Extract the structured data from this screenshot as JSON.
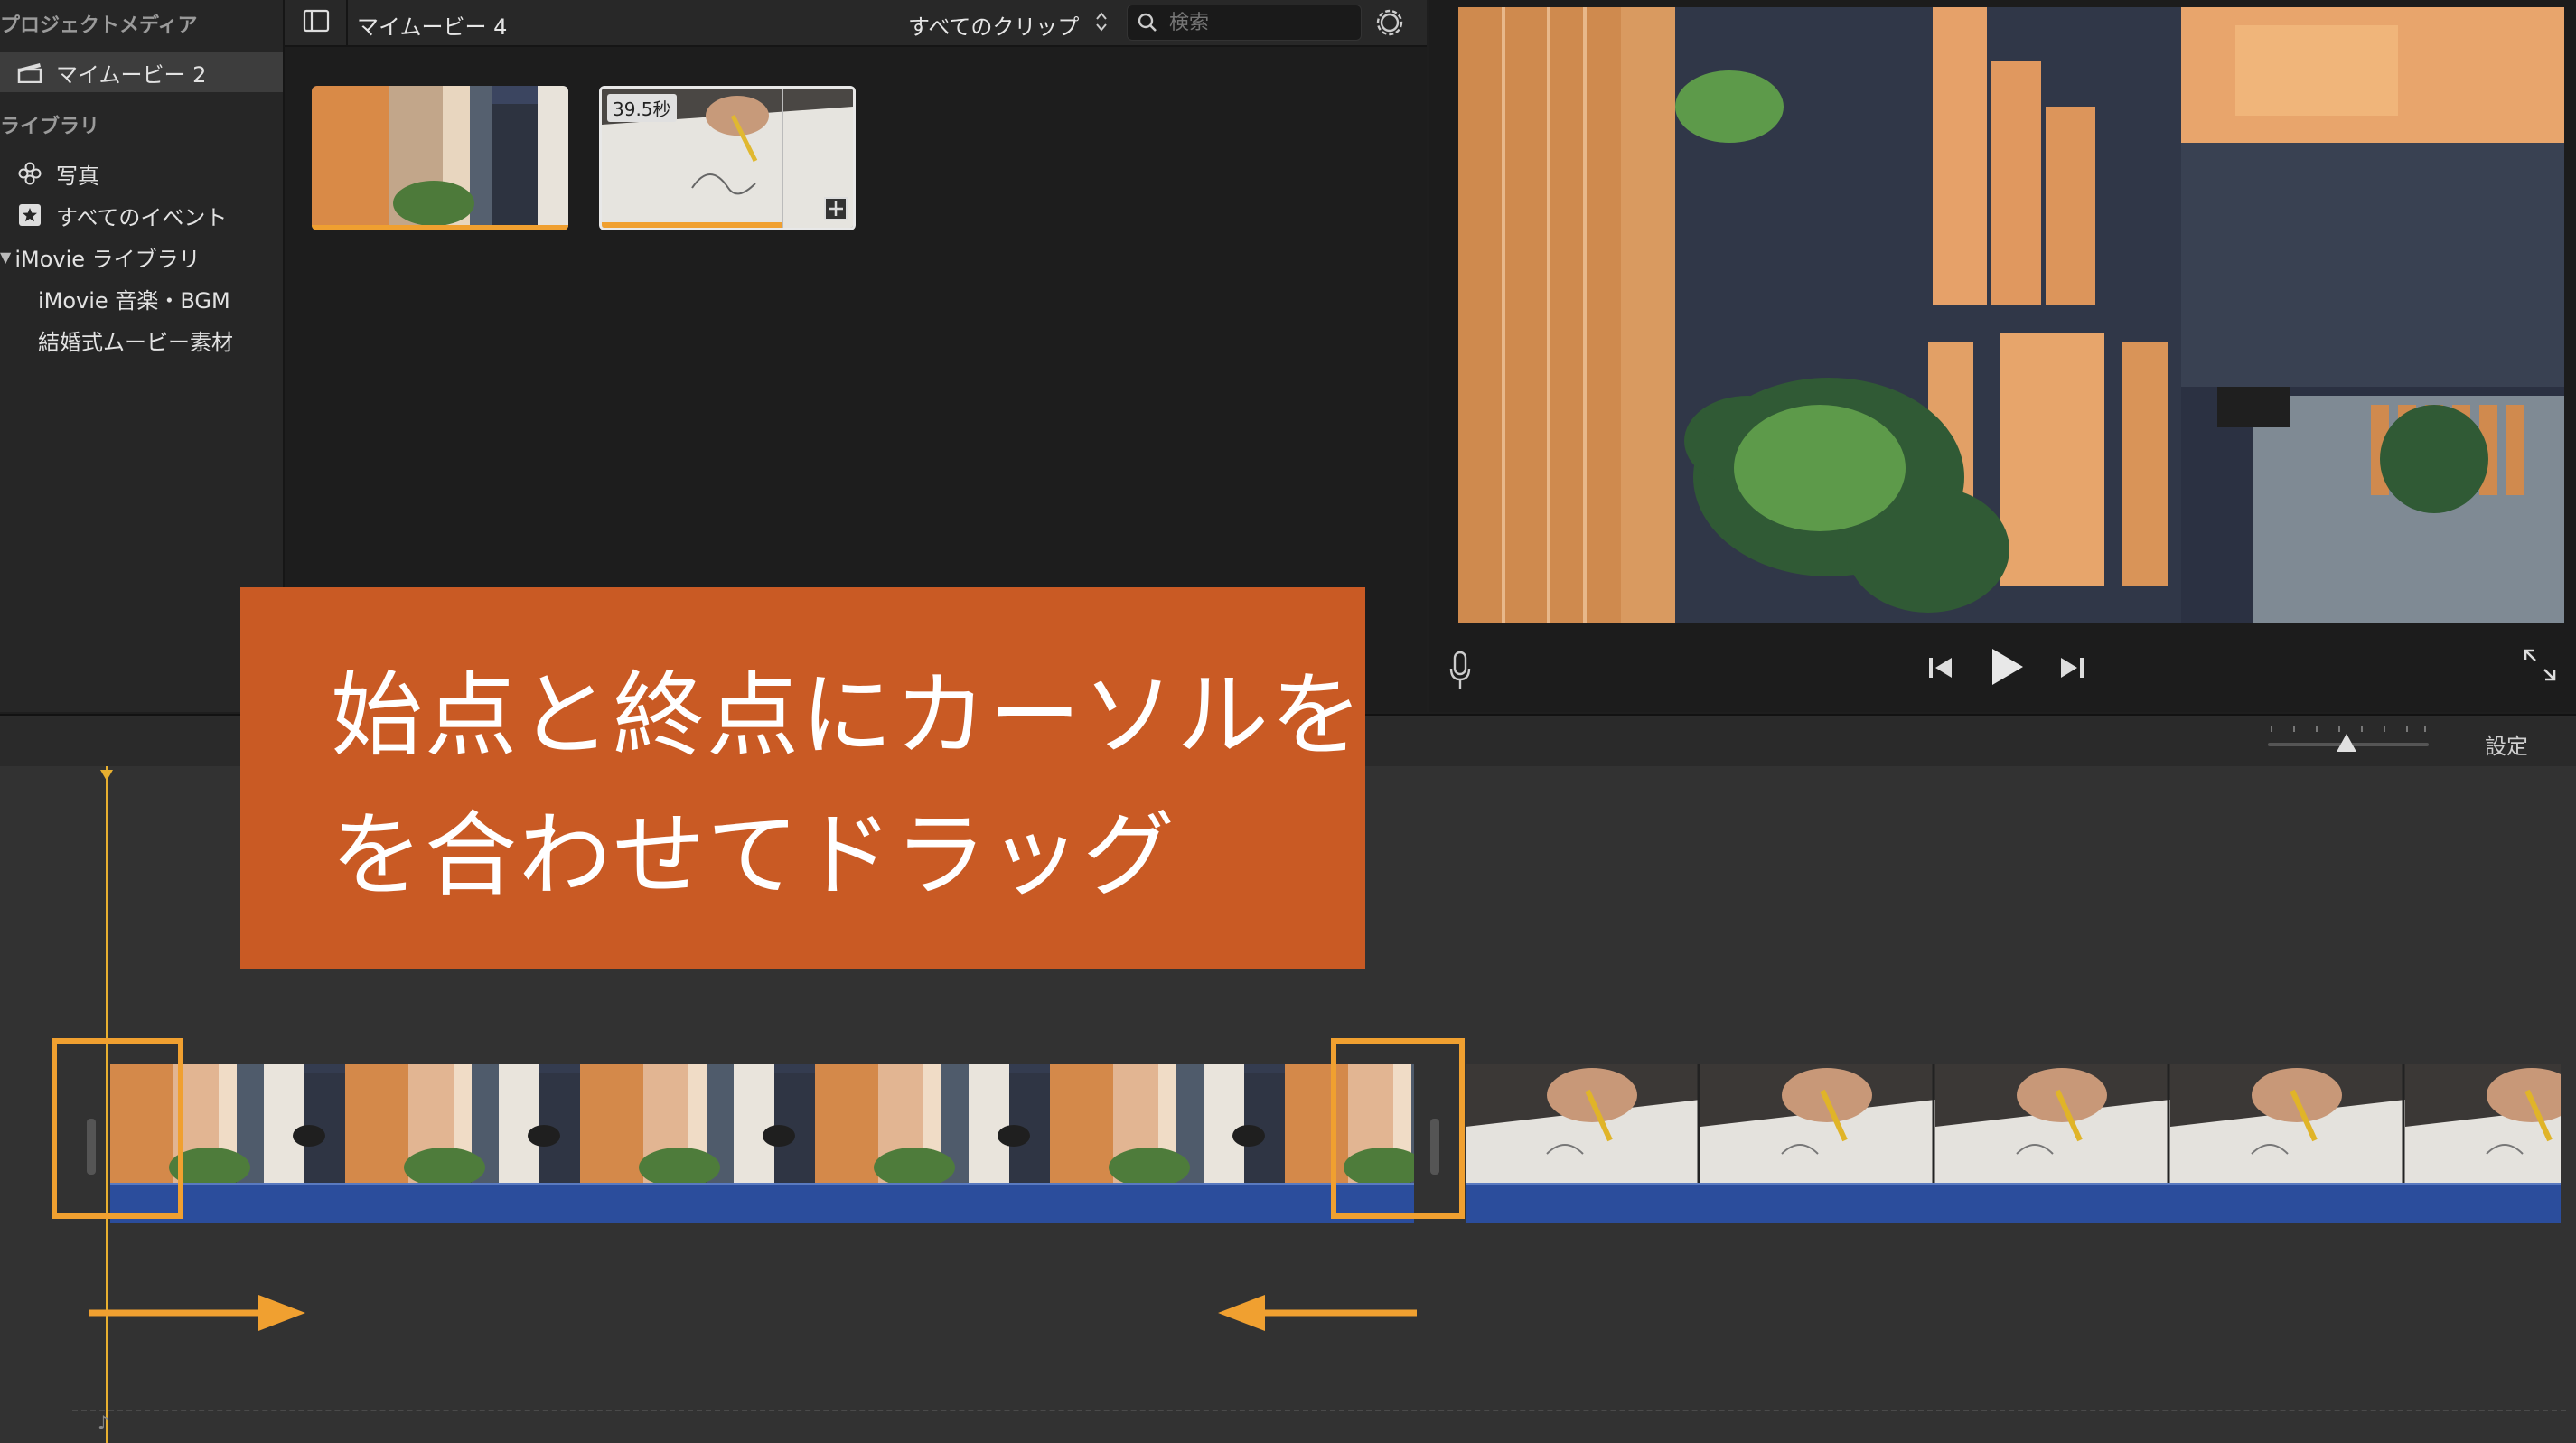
{
  "sidebar": {
    "project_media_header": "プロジェクトメディア",
    "project_item": "マイムービー 2",
    "library_header": "ライブラリ",
    "items": [
      {
        "label": "写真",
        "icon": "photos-flower-icon"
      },
      {
        "label": "すべてのイベント",
        "icon": "star-icon"
      }
    ],
    "imovie_library": "iMovie ライブラリ",
    "events": [
      "iMovie 音楽・BGM",
      "結婚式ムービー素材"
    ]
  },
  "browser": {
    "title": "マイムービー 4",
    "filter_label": "すべてのクリップ",
    "search_placeholder": "検索",
    "clip2_duration": "39.5秒"
  },
  "timeline": {
    "settings_label": "設定"
  },
  "callout": {
    "line1": "始点と終点にカーソルを",
    "line2": "を合わせてドラッグ"
  },
  "colors": {
    "accent_orange": "#f0a030",
    "callout_bg": "#c95a24",
    "audio_blue": "#2b4d9c"
  }
}
